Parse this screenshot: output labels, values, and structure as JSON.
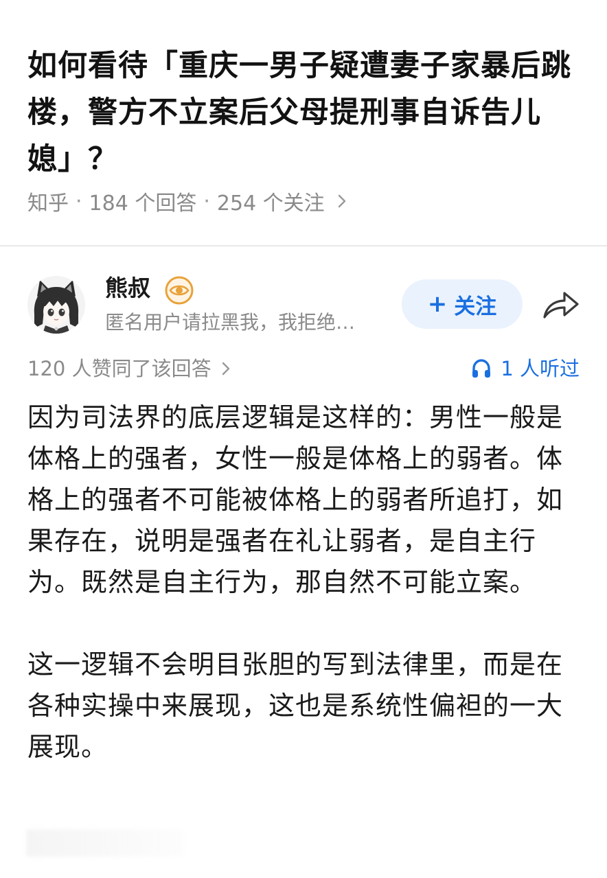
{
  "question": {
    "title": "如何看待「重庆一男子疑遭妻子家暴后跳楼，警方不立案后父母提刑事自诉告儿媳」？",
    "source": "知乎",
    "answers_count": "184 个回答",
    "followers_count": "254 个关注"
  },
  "author": {
    "name": "熊叔",
    "bio": "匿名用户请拉黑我，我拒绝…",
    "follow_label": "关注",
    "badge_icon": "eye-badge-icon",
    "avatar": "anime-girl-avatar"
  },
  "stats": {
    "upvotes": "120 人赞同了该回答",
    "listeners": "1 人听过"
  },
  "answer": {
    "paragraphs": [
      "因为司法界的底层逻辑是这样的：男性一般是体格上的强者，女性一般是体格上的弱者。体格上的强者不可能被体格上的弱者所追打，如果存在，说明是强者在礼让弱者，是自主行为。既然是自主行为，那自然不可能立案。",
      "这一逻辑不会明目张胆的写到法律里，而是在各种实操中来展现，这也是系统性偏袒的一大展现。"
    ]
  },
  "colors": {
    "accent": "#1a6fe0",
    "follow_bg": "#eaf2fd",
    "muted_text": "#8a8a8a",
    "badge": "#e8a23a"
  }
}
